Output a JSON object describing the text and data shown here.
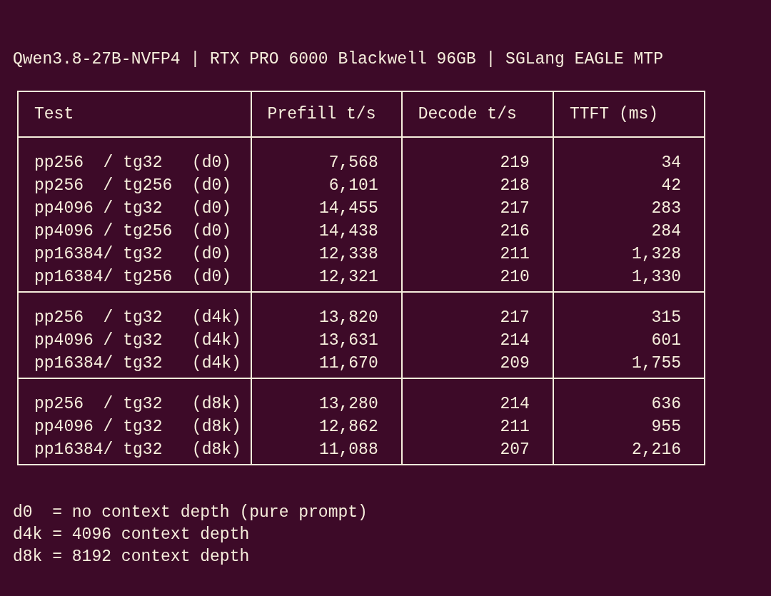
{
  "title": "Qwen3.8-27B-NVFP4 | RTX PRO 6000 Blackwell 96GB | SGLang EAGLE MTP",
  "table": {
    "columns": [
      "Test",
      "Prefill t/s",
      "Decode t/s",
      "TTFT (ms)"
    ],
    "groups": [
      {
        "rows": [
          [
            "pp256  / tg32   (d0)",
            "7,568",
            "219",
            "34"
          ],
          [
            "pp256  / tg256  (d0)",
            "6,101",
            "218",
            "42"
          ],
          [
            "pp4096 / tg32   (d0)",
            "14,455",
            "217",
            "283"
          ],
          [
            "pp4096 / tg256  (d0)",
            "14,438",
            "216",
            "284"
          ],
          [
            "pp16384/ tg32   (d0)",
            "12,338",
            "211",
            "1,328"
          ],
          [
            "pp16384/ tg256  (d0)",
            "12,321",
            "210",
            "1,330"
          ]
        ]
      },
      {
        "rows": [
          [
            "pp256  / tg32   (d4k)",
            "13,820",
            "217",
            "315"
          ],
          [
            "pp4096 / tg32   (d4k)",
            "13,631",
            "214",
            "601"
          ],
          [
            "pp16384/ tg32   (d4k)",
            "11,670",
            "209",
            "1,755"
          ]
        ]
      },
      {
        "rows": [
          [
            "pp256  / tg32   (d8k)",
            "13,280",
            "214",
            "636"
          ],
          [
            "pp4096 / tg32   (d8k)",
            "12,862",
            "211",
            "955"
          ],
          [
            "pp16384/ tg32   (d8k)",
            "11,088",
            "207",
            "2,216"
          ]
        ]
      }
    ]
  },
  "legend": [
    "d0  = no context depth (pure prompt)",
    "d4k = 4096 context depth",
    "d8k = 8192 context depth"
  ]
}
